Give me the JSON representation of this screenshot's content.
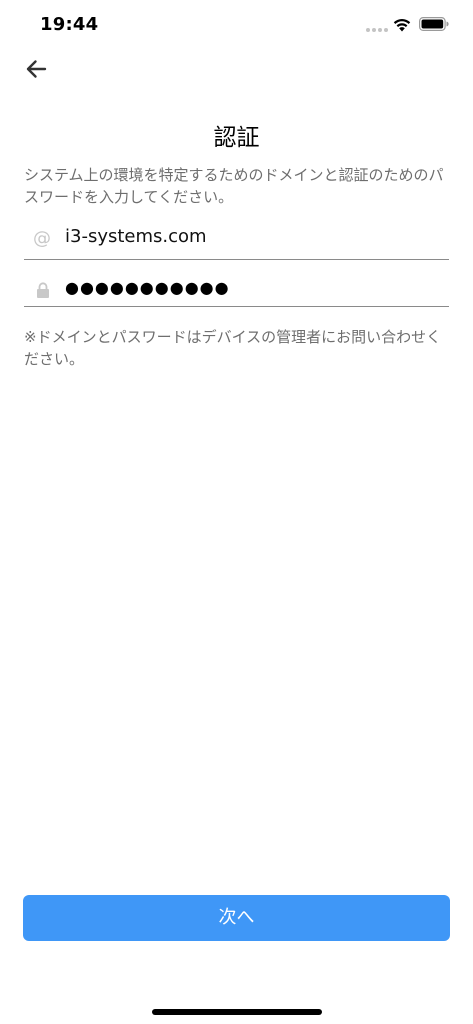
{
  "status_bar": {
    "time": "19:44",
    "icons": [
      "signal-dots-icon",
      "wifi-icon",
      "battery-icon"
    ]
  },
  "header": {
    "back_icon": "arrow-left-icon",
    "title": "認証"
  },
  "description": "システム上の環境を特定するためのドメインと認証のためのパスワードを入力してください。",
  "form": {
    "domain": {
      "icon": "at-sign-icon",
      "icon_glyph": "@",
      "value": "i3-systems.com"
    },
    "password": {
      "icon": "lock-icon",
      "masked_value": "●●●●●●●●●●●"
    }
  },
  "note": "※ドメインとパスワードはデバイスの管理者にお問い合わせください。",
  "footer": {
    "next_label": "次へ"
  },
  "colors": {
    "accent": "#3f97f7",
    "secondary_text": "#6e6e6e",
    "divider": "#8a8a8a"
  }
}
